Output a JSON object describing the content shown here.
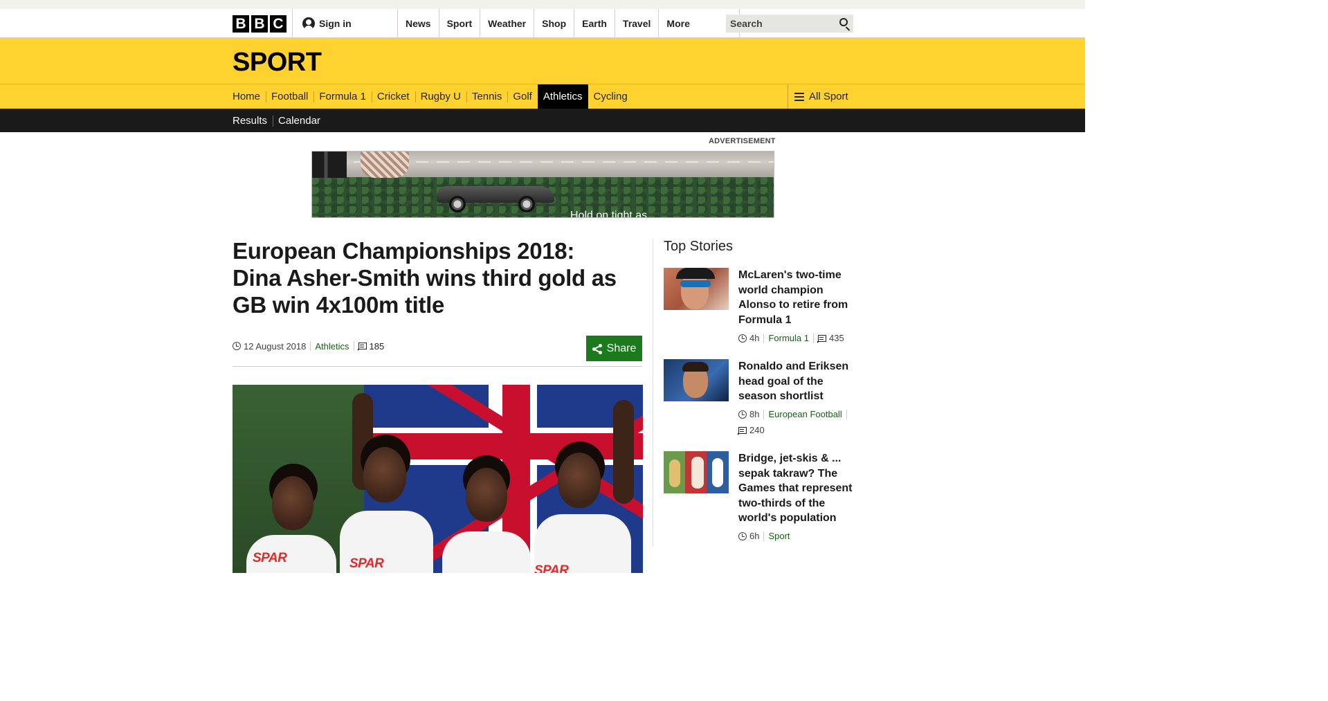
{
  "global_nav": {
    "logo_letters": [
      "B",
      "B",
      "C"
    ],
    "sign_in": "Sign in",
    "links": [
      "News",
      "Sport",
      "Weather",
      "Shop",
      "Earth",
      "Travel"
    ],
    "more": "More",
    "search_placeholder": "Search"
  },
  "sport": {
    "title": "SPORT",
    "nav": [
      "Home",
      "Football",
      "Formula 1",
      "Cricket",
      "Rugby U",
      "Tennis",
      "Golf",
      "Athletics",
      "Cycling"
    ],
    "active": "Athletics",
    "all_sport": "All Sport",
    "subnav": [
      "Results",
      "Calendar"
    ]
  },
  "advert": {
    "label": "ADVERTISEMENT",
    "tagline": "Hold on tight as"
  },
  "article": {
    "headline": "European Championships 2018: Dina Asher-Smith wins third gold as GB win 4x100m title",
    "date": "12 August 2018",
    "topic": "Athletics",
    "comments": "185",
    "share": "Share",
    "image_sponsor": "SPAR"
  },
  "sidebar": {
    "title": "Top Stories",
    "stories": [
      {
        "title": "McLaren's two-time world champion Alonso to retire from Formula 1",
        "time": "4h",
        "topic": "Formula 1",
        "comments": "435"
      },
      {
        "title": "Ronaldo and Eriksen head goal of the season shortlist",
        "time": "8h",
        "topic": "European Football",
        "comments": "240"
      },
      {
        "title": "Bridge, jet-skis & ... sepak takraw? The Games that represent two-thirds of the world's population",
        "time": "6h",
        "topic": "Sport"
      }
    ]
  },
  "colors": {
    "sport_yellow": "#ffd230",
    "subnav_black": "#1a1a1a",
    "link_green": "#1a5c1a",
    "share_green": "#1b7a1b"
  }
}
